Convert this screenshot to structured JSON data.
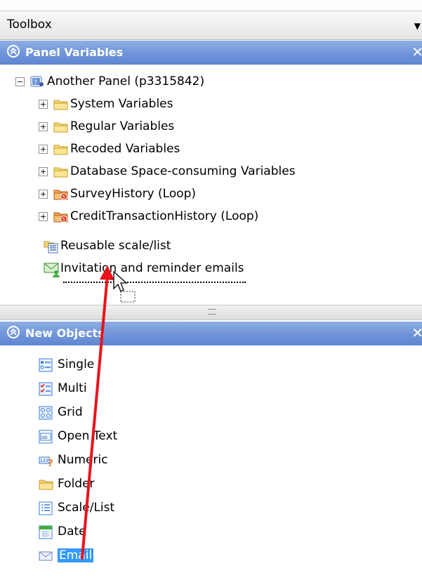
{
  "toolbox": {
    "title": "Toolbox"
  },
  "panel_variables": {
    "title": "Panel Variables",
    "root": {
      "label": "Another Panel (p3315842)",
      "icon": "panel-icon"
    },
    "children": [
      {
        "label": "System Variables",
        "icon": "folder-icon"
      },
      {
        "label": "Regular Variables",
        "icon": "folder-icon"
      },
      {
        "label": "Recoded Variables",
        "icon": "folder-icon"
      },
      {
        "label": "Database Space-consuming Variables",
        "icon": "folder-icon"
      },
      {
        "label": "SurveyHistory (Loop)",
        "icon": "loop-folder-icon"
      },
      {
        "label": "CreditTransactionHistory (Loop)",
        "icon": "loop-folder-icon"
      }
    ],
    "extras": [
      {
        "label": "Reusable scale/list",
        "icon": "scale-list-icon"
      },
      {
        "label": "Invitation and reminder emails",
        "icon": "email-invitation-icon"
      }
    ]
  },
  "new_objects": {
    "title": "New Objects",
    "items": [
      {
        "label": "Single",
        "icon": "single-choice-icon"
      },
      {
        "label": "Multi",
        "icon": "multi-choice-icon"
      },
      {
        "label": "Grid",
        "icon": "grid-icon"
      },
      {
        "label": "Open Text",
        "icon": "open-text-icon"
      },
      {
        "label": "Numeric",
        "icon": "numeric-icon"
      },
      {
        "label": "Folder",
        "icon": "folder-icon"
      },
      {
        "label": "Scale/List",
        "icon": "scale-list-icon"
      },
      {
        "label": "Date",
        "icon": "date-icon"
      },
      {
        "label": "Email",
        "icon": "email-icon",
        "selected": true
      }
    ]
  },
  "colors": {
    "panel_header": "#6f94d9",
    "selection": "#3399ff",
    "annotation_arrow": "#e8141c"
  }
}
